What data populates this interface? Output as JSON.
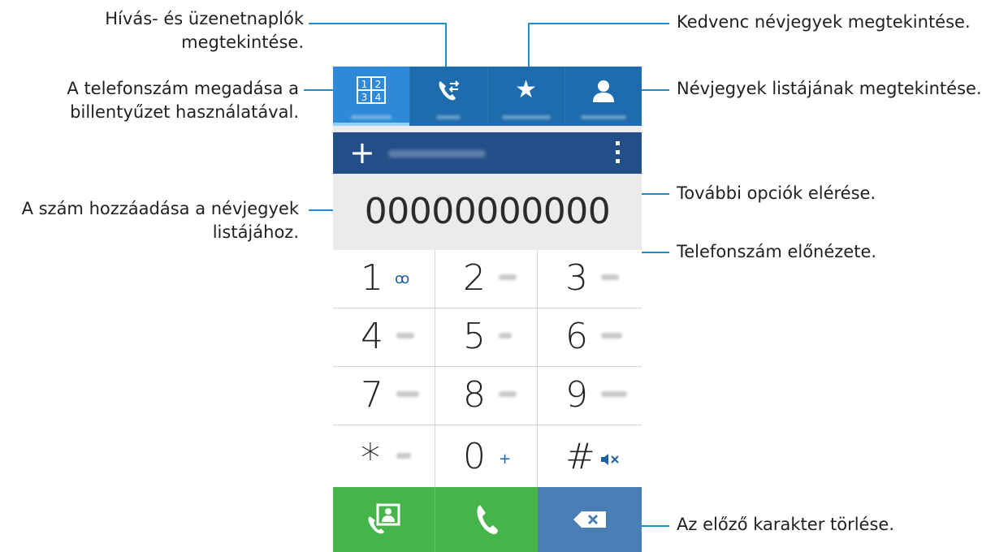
{
  "annotations": {
    "left": [
      {
        "lines": [
          "Hívás- és üzenetnaplók",
          "megtekintése."
        ]
      },
      {
        "lines": [
          "A telefonszám megadása a",
          "billentyűzet használatával."
        ]
      },
      {
        "lines": [
          "A szám hozzáadása a névjegyek",
          "listájához."
        ]
      }
    ],
    "right": [
      {
        "lines": [
          "Kedvenc névjegyek megtekintése."
        ]
      },
      {
        "lines": [
          "Névjegyek listájának megtekintése."
        ]
      },
      {
        "lines": [
          "További opciók elérése."
        ]
      },
      {
        "lines": [
          "Telefonszám előnézete."
        ]
      },
      {
        "lines": [
          "Az előző karakter törlése."
        ]
      }
    ]
  },
  "phone": {
    "tabs": [
      {
        "icon": "keypad-icon",
        "glyph": "",
        "active": true
      },
      {
        "icon": "call-log-icon",
        "glyph": "",
        "active": false
      },
      {
        "icon": "star-icon",
        "glyph": "★",
        "active": false
      },
      {
        "icon": "contact-person-icon",
        "glyph": "",
        "active": false
      }
    ],
    "action_bar": {
      "add_glyph": "+"
    },
    "number_display": "00000000000",
    "keys": [
      {
        "digit": "1",
        "sub": "ꝏ",
        "sub_type": "voicemail"
      },
      {
        "digit": "2",
        "sub": "",
        "sub_type": "blur"
      },
      {
        "digit": "3",
        "sub": "",
        "sub_type": "blur"
      },
      {
        "digit": "4",
        "sub": "",
        "sub_type": "blur"
      },
      {
        "digit": "5",
        "sub": "",
        "sub_type": "blur"
      },
      {
        "digit": "6",
        "sub": "",
        "sub_type": "blur"
      },
      {
        "digit": "7",
        "sub": "",
        "sub_type": "blur"
      },
      {
        "digit": "8",
        "sub": "",
        "sub_type": "blur"
      },
      {
        "digit": "9",
        "sub": "",
        "sub_type": "blur"
      },
      {
        "digit": "*",
        "sub": "",
        "sub_type": "blur"
      },
      {
        "digit": "0",
        "sub": "+",
        "sub_type": "plus"
      },
      {
        "digit": "#",
        "sub": "",
        "sub_type": "mute"
      }
    ],
    "colors": {
      "accent": "#1e8fce",
      "tab_bar": "#1e6cad",
      "active_tab": "#2e8ad8",
      "action_bar": "#234f88",
      "call_green": "#45b449",
      "delete_blue": "#4a7fb5"
    }
  }
}
